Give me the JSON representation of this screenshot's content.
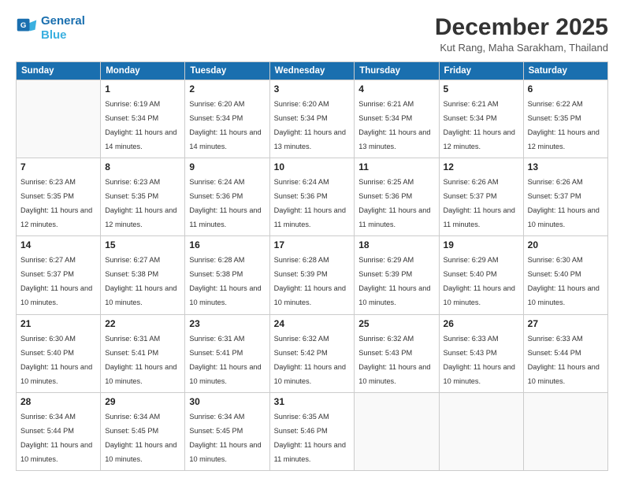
{
  "header": {
    "logo_line1": "General",
    "logo_line2": "Blue",
    "month": "December 2025",
    "location": "Kut Rang, Maha Sarakham, Thailand"
  },
  "weekdays": [
    "Sunday",
    "Monday",
    "Tuesday",
    "Wednesday",
    "Thursday",
    "Friday",
    "Saturday"
  ],
  "weeks": [
    [
      {
        "day": "",
        "sunrise": "",
        "sunset": "",
        "daylight": ""
      },
      {
        "day": "1",
        "sunrise": "Sunrise: 6:19 AM",
        "sunset": "Sunset: 5:34 PM",
        "daylight": "Daylight: 11 hours and 14 minutes."
      },
      {
        "day": "2",
        "sunrise": "Sunrise: 6:20 AM",
        "sunset": "Sunset: 5:34 PM",
        "daylight": "Daylight: 11 hours and 14 minutes."
      },
      {
        "day": "3",
        "sunrise": "Sunrise: 6:20 AM",
        "sunset": "Sunset: 5:34 PM",
        "daylight": "Daylight: 11 hours and 13 minutes."
      },
      {
        "day": "4",
        "sunrise": "Sunrise: 6:21 AM",
        "sunset": "Sunset: 5:34 PM",
        "daylight": "Daylight: 11 hours and 13 minutes."
      },
      {
        "day": "5",
        "sunrise": "Sunrise: 6:21 AM",
        "sunset": "Sunset: 5:34 PM",
        "daylight": "Daylight: 11 hours and 12 minutes."
      },
      {
        "day": "6",
        "sunrise": "Sunrise: 6:22 AM",
        "sunset": "Sunset: 5:35 PM",
        "daylight": "Daylight: 11 hours and 12 minutes."
      }
    ],
    [
      {
        "day": "7",
        "sunrise": "Sunrise: 6:23 AM",
        "sunset": "Sunset: 5:35 PM",
        "daylight": "Daylight: 11 hours and 12 minutes."
      },
      {
        "day": "8",
        "sunrise": "Sunrise: 6:23 AM",
        "sunset": "Sunset: 5:35 PM",
        "daylight": "Daylight: 11 hours and 12 minutes."
      },
      {
        "day": "9",
        "sunrise": "Sunrise: 6:24 AM",
        "sunset": "Sunset: 5:36 PM",
        "daylight": "Daylight: 11 hours and 11 minutes."
      },
      {
        "day": "10",
        "sunrise": "Sunrise: 6:24 AM",
        "sunset": "Sunset: 5:36 PM",
        "daylight": "Daylight: 11 hours and 11 minutes."
      },
      {
        "day": "11",
        "sunrise": "Sunrise: 6:25 AM",
        "sunset": "Sunset: 5:36 PM",
        "daylight": "Daylight: 11 hours and 11 minutes."
      },
      {
        "day": "12",
        "sunrise": "Sunrise: 6:26 AM",
        "sunset": "Sunset: 5:37 PM",
        "daylight": "Daylight: 11 hours and 11 minutes."
      },
      {
        "day": "13",
        "sunrise": "Sunrise: 6:26 AM",
        "sunset": "Sunset: 5:37 PM",
        "daylight": "Daylight: 11 hours and 10 minutes."
      }
    ],
    [
      {
        "day": "14",
        "sunrise": "Sunrise: 6:27 AM",
        "sunset": "Sunset: 5:37 PM",
        "daylight": "Daylight: 11 hours and 10 minutes."
      },
      {
        "day": "15",
        "sunrise": "Sunrise: 6:27 AM",
        "sunset": "Sunset: 5:38 PM",
        "daylight": "Daylight: 11 hours and 10 minutes."
      },
      {
        "day": "16",
        "sunrise": "Sunrise: 6:28 AM",
        "sunset": "Sunset: 5:38 PM",
        "daylight": "Daylight: 11 hours and 10 minutes."
      },
      {
        "day": "17",
        "sunrise": "Sunrise: 6:28 AM",
        "sunset": "Sunset: 5:39 PM",
        "daylight": "Daylight: 11 hours and 10 minutes."
      },
      {
        "day": "18",
        "sunrise": "Sunrise: 6:29 AM",
        "sunset": "Sunset: 5:39 PM",
        "daylight": "Daylight: 11 hours and 10 minutes."
      },
      {
        "day": "19",
        "sunrise": "Sunrise: 6:29 AM",
        "sunset": "Sunset: 5:40 PM",
        "daylight": "Daylight: 11 hours and 10 minutes."
      },
      {
        "day": "20",
        "sunrise": "Sunrise: 6:30 AM",
        "sunset": "Sunset: 5:40 PM",
        "daylight": "Daylight: 11 hours and 10 minutes."
      }
    ],
    [
      {
        "day": "21",
        "sunrise": "Sunrise: 6:30 AM",
        "sunset": "Sunset: 5:40 PM",
        "daylight": "Daylight: 11 hours and 10 minutes."
      },
      {
        "day": "22",
        "sunrise": "Sunrise: 6:31 AM",
        "sunset": "Sunset: 5:41 PM",
        "daylight": "Daylight: 11 hours and 10 minutes."
      },
      {
        "day": "23",
        "sunrise": "Sunrise: 6:31 AM",
        "sunset": "Sunset: 5:41 PM",
        "daylight": "Daylight: 11 hours and 10 minutes."
      },
      {
        "day": "24",
        "sunrise": "Sunrise: 6:32 AM",
        "sunset": "Sunset: 5:42 PM",
        "daylight": "Daylight: 11 hours and 10 minutes."
      },
      {
        "day": "25",
        "sunrise": "Sunrise: 6:32 AM",
        "sunset": "Sunset: 5:43 PM",
        "daylight": "Daylight: 11 hours and 10 minutes."
      },
      {
        "day": "26",
        "sunrise": "Sunrise: 6:33 AM",
        "sunset": "Sunset: 5:43 PM",
        "daylight": "Daylight: 11 hours and 10 minutes."
      },
      {
        "day": "27",
        "sunrise": "Sunrise: 6:33 AM",
        "sunset": "Sunset: 5:44 PM",
        "daylight": "Daylight: 11 hours and 10 minutes."
      }
    ],
    [
      {
        "day": "28",
        "sunrise": "Sunrise: 6:34 AM",
        "sunset": "Sunset: 5:44 PM",
        "daylight": "Daylight: 11 hours and 10 minutes."
      },
      {
        "day": "29",
        "sunrise": "Sunrise: 6:34 AM",
        "sunset": "Sunset: 5:45 PM",
        "daylight": "Daylight: 11 hours and 10 minutes."
      },
      {
        "day": "30",
        "sunrise": "Sunrise: 6:34 AM",
        "sunset": "Sunset: 5:45 PM",
        "daylight": "Daylight: 11 hours and 10 minutes."
      },
      {
        "day": "31",
        "sunrise": "Sunrise: 6:35 AM",
        "sunset": "Sunset: 5:46 PM",
        "daylight": "Daylight: 11 hours and 11 minutes."
      },
      {
        "day": "",
        "sunrise": "",
        "sunset": "",
        "daylight": ""
      },
      {
        "day": "",
        "sunrise": "",
        "sunset": "",
        "daylight": ""
      },
      {
        "day": "",
        "sunrise": "",
        "sunset": "",
        "daylight": ""
      }
    ]
  ]
}
